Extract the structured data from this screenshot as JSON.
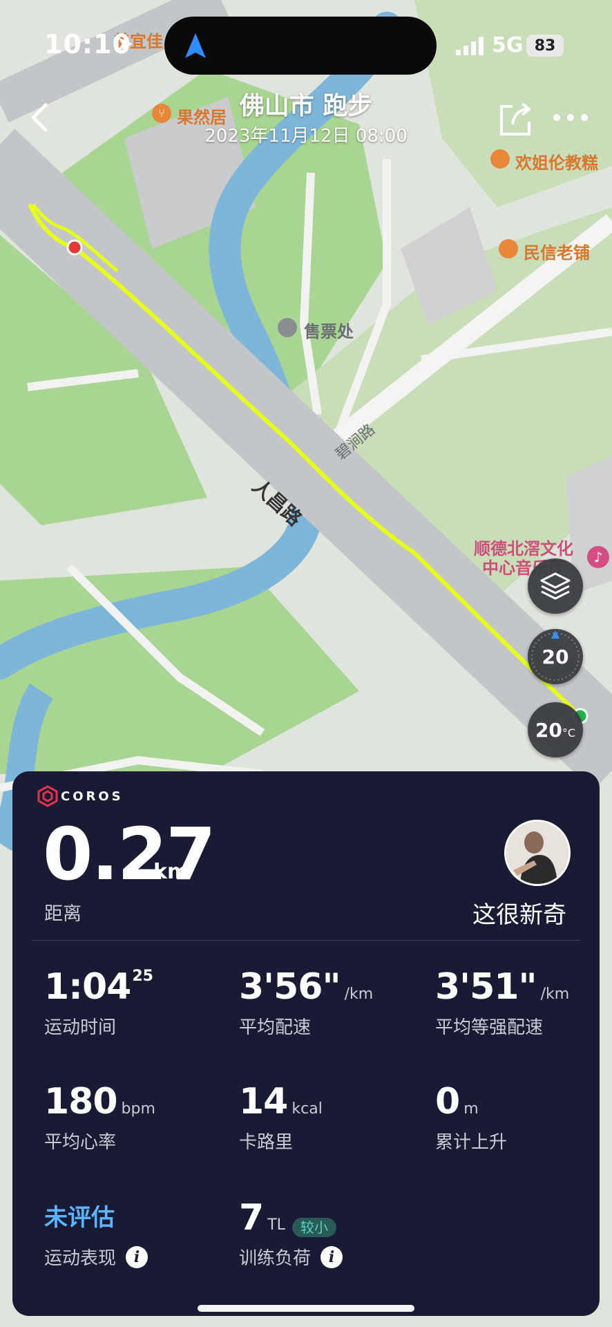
{
  "status_bar": {
    "time": "10:10",
    "network": "5G",
    "battery": "83"
  },
  "header": {
    "title": "佛山市 跑步",
    "subtitle": "2023年11月12日 08:00"
  },
  "map": {
    "pois": {
      "p1": "美宜佳",
      "p2": "果然居",
      "p3": "欢姐伦教糕",
      "p4": "民信老铺",
      "p5": "售票处",
      "p6_line1": "顺德北滘文化",
      "p6_line2": "中心音乐厅"
    },
    "roads": {
      "main": "人昌路",
      "side": "碧涧路"
    },
    "controls": {
      "compass_value": "20",
      "temperature": "20",
      "temperature_unit": "°C"
    },
    "colors": {
      "track": "#e6ff1a",
      "water": "#7eb6d9",
      "park": "#a5d48f",
      "road": "#bfc3c6"
    }
  },
  "card": {
    "brand": "COROS",
    "distance": {
      "value": "0.27",
      "unit": "km",
      "label": "距离"
    },
    "badge": "这很新奇",
    "stats": {
      "time": {
        "value": "1:04",
        "sup": "25",
        "label": "运动时间"
      },
      "avg_pace": {
        "value": "3'56\"",
        "unit": "/km",
        "label": "平均配速"
      },
      "grade_pace": {
        "value": "3'51\"",
        "unit": "/km",
        "label": "平均等强配速"
      },
      "heart_rate": {
        "value": "180",
        "unit": "bpm",
        "label": "平均心率"
      },
      "calories": {
        "value": "14",
        "unit": "kcal",
        "label": "卡路里"
      },
      "ascent": {
        "value": "0",
        "unit": "m",
        "label": "累计上升"
      },
      "performance": {
        "value": "未评估",
        "label": "运动表现"
      },
      "training_load": {
        "value": "7",
        "unit": "TL",
        "tag": "较小",
        "label": "训练负荷"
      }
    },
    "info_icon_glyph": "i"
  }
}
